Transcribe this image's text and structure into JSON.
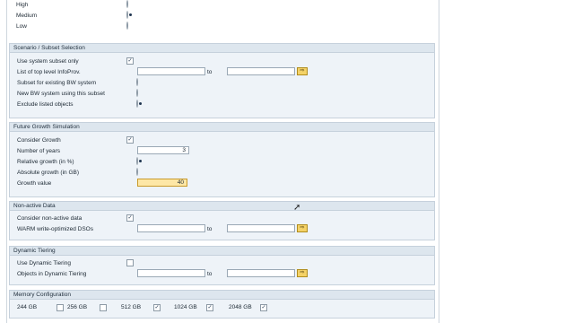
{
  "priority": {
    "options": [
      {
        "label": "High",
        "selected": false
      },
      {
        "label": "Medium",
        "selected": true
      },
      {
        "label": "Low",
        "selected": false
      }
    ]
  },
  "scenario": {
    "title": "Scenario / Subset Selection",
    "use_subset_label": "Use system subset only",
    "use_subset_checked": true,
    "list_label": "List of top level InfoProv.",
    "to_label": "to",
    "subset_existing_label": "Subset for existing BW system",
    "new_bw_label": "New BW system using this subset",
    "exclude_label": "Exclude listed objects",
    "selected_option": "exclude"
  },
  "growth": {
    "title": "Future Growth Simulation",
    "consider_label": "Consider Growth",
    "consider_checked": true,
    "years_label": "Number of years",
    "years_value": "3",
    "relative_label": "Relative growth (in %)",
    "absolute_label": "Absolute growth (in GB)",
    "selected_mode": "relative",
    "growth_value_label": "Growth value",
    "growth_value": "40"
  },
  "nonactive": {
    "title": "Non-active Data",
    "consider_label": "Consider non-active data",
    "consider_checked": true,
    "warm_label": "WARM write-optimized DSOs",
    "to_label": "to"
  },
  "tiering": {
    "title": "Dynamic Tiering",
    "use_label": "Use Dynamic Tiering",
    "use_checked": false,
    "objects_label": "Objects in Dynamic Tiering",
    "to_label": "to"
  },
  "memory": {
    "title": "Memory Configuration",
    "sizes": [
      {
        "label": "244 GB",
        "checked": false
      },
      {
        "label": "256 GB",
        "checked": false
      },
      {
        "label": "512 GB",
        "checked": true
      },
      {
        "label": "1024 GB",
        "checked": true
      },
      {
        "label": "2048 GB",
        "checked": true
      }
    ]
  },
  "icons": {
    "multiple_selection": "multiple-selection-icon",
    "check": "checkmark-glyph",
    "cursor": "mouse-pointer-icon"
  },
  "colors": {
    "group_bg": "#eef3f8",
    "group_header": "#dde6ee",
    "highlight_input": "#fde7a6",
    "multisel_button": "#f4d267"
  }
}
